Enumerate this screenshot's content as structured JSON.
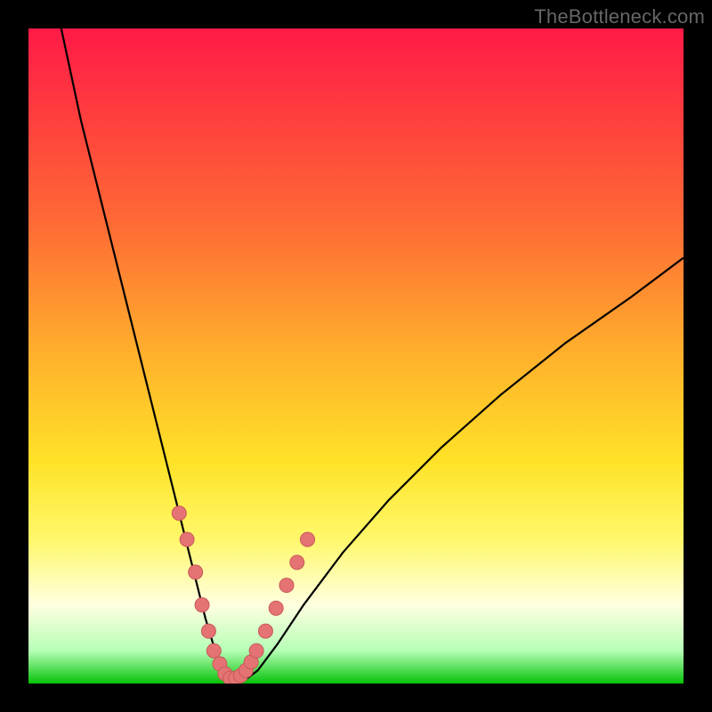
{
  "watermark": "TheBottleneck.com",
  "colors": {
    "frame": "#000000",
    "curve": "#000000",
    "marker_fill": "#e57373",
    "marker_stroke": "#c85a5a"
  },
  "chart_data": {
    "type": "line",
    "title": "",
    "xlabel": "",
    "ylabel": "",
    "xlim": [
      0,
      100
    ],
    "ylim": [
      0,
      100
    ],
    "curve": {
      "x": [
        5,
        8,
        12,
        16,
        20,
        23,
        25,
        27,
        28.5,
        30,
        31.5,
        33,
        35,
        38,
        42,
        48,
        55,
        63,
        72,
        82,
        92,
        100
      ],
      "y": [
        100,
        86,
        70,
        54,
        38,
        26,
        18,
        10,
        5,
        2,
        0.5,
        0.5,
        2,
        6,
        12,
        20,
        28,
        36,
        44,
        52,
        59,
        65
      ]
    },
    "markers": {
      "x": [
        23,
        24.2,
        25.5,
        26.5,
        27.5,
        28.3,
        29.2,
        30,
        30.8,
        31.6,
        32.4,
        33.2,
        34,
        34.8,
        36.2,
        37.8,
        39.4,
        41,
        42.6
      ],
      "y": [
        26,
        22,
        17,
        12,
        8,
        5,
        3,
        1.5,
        0.8,
        0.8,
        1.2,
        2,
        3.3,
        5,
        8,
        11.5,
        15,
        18.5,
        22
      ]
    }
  }
}
